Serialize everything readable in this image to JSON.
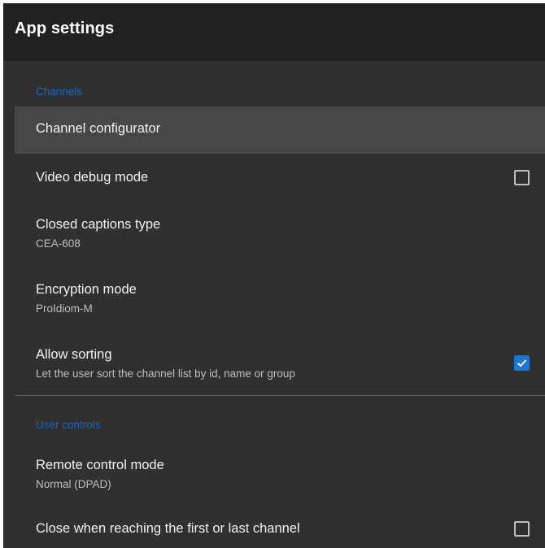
{
  "appbar": {
    "title": "App settings"
  },
  "categories": {
    "channels": "Channels",
    "user_controls": "User controls"
  },
  "prefs": {
    "channel_configurator": {
      "title": "Channel configurator"
    },
    "video_debug_mode": {
      "title": "Video debug mode",
      "checked": false
    },
    "closed_captions_type": {
      "title": "Closed captions type",
      "summary": "CEA-608"
    },
    "encryption_mode": {
      "title": "Encryption mode",
      "summary": "ProIdiom-M"
    },
    "allow_sorting": {
      "title": "Allow sorting",
      "summary": "Let the user sort the channel list by id, name or group",
      "checked": true
    },
    "remote_control_mode": {
      "title": "Remote control mode",
      "summary": "Normal (DPAD)"
    },
    "close_when_reaching": {
      "title": "Close when reaching the first or last channel",
      "checked": false
    }
  },
  "colors": {
    "accent": "#1976d2",
    "category_text": "#1565c0",
    "background": "#303030",
    "appbar": "#212121",
    "highlight": "#474747"
  },
  "icons": {
    "checkbox_unchecked": "checkbox-outline-icon",
    "checkbox_checked": "checkbox-checked-icon"
  }
}
